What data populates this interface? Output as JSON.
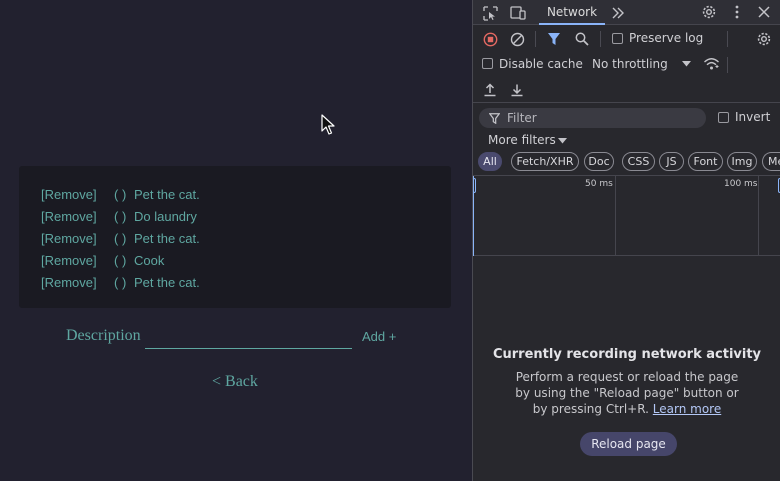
{
  "app": {
    "todos": [
      {
        "remove_label": "[Remove]",
        "check_label": "( )",
        "text": "Pet the cat."
      },
      {
        "remove_label": "[Remove]",
        "check_label": "( )",
        "text": "Do laundry"
      },
      {
        "remove_label": "[Remove]",
        "check_label": "( )",
        "text": "Pet the cat."
      },
      {
        "remove_label": "[Remove]",
        "check_label": "( )",
        "text": "Cook"
      },
      {
        "remove_label": "[Remove]",
        "check_label": "( )",
        "text": "Pet the cat."
      }
    ],
    "description_label": "Description",
    "description_value": "",
    "add_label": "Add +",
    "back_label": "< Back"
  },
  "devtools": {
    "active_tab": "Network",
    "preserve_log": {
      "label": "Preserve log",
      "checked": false
    },
    "disable_cache": {
      "label": "Disable cache",
      "checked": false
    },
    "throttling": "No throttling",
    "filter": {
      "placeholder": "Filter",
      "invert_label": "Invert"
    },
    "more_filters": "More filters",
    "type_filters": [
      "All",
      "Fetch/XHR",
      "Doc",
      "CSS",
      "JS",
      "Font",
      "Img",
      "Me"
    ],
    "timeline_ticks": [
      "50 ms",
      "100 ms"
    ],
    "empty_state": {
      "title": "Currently recording network activity",
      "description": "Perform a request or reload the page by using the \"Reload page\" button or by pressing Ctrl+R.",
      "learn_more": "Learn more",
      "reload_button": "Reload page"
    },
    "colors": {
      "record": "#e46962",
      "accent": "#8ab4f8",
      "chip_active": "#4a4a6e"
    }
  }
}
